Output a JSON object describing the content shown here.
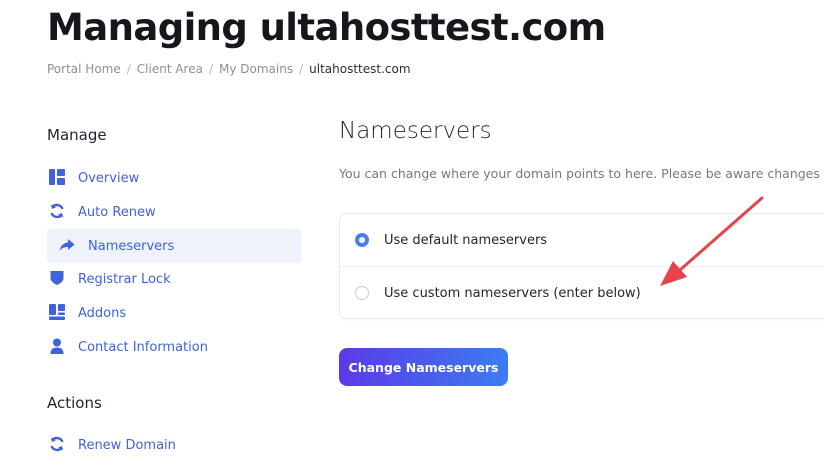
{
  "page": {
    "title": "Managing ultahosttest.com"
  },
  "breadcrumb": {
    "items": [
      "Portal Home",
      "Client Area",
      "My Domains"
    ],
    "separator": "/",
    "current": "ultahosttest.com"
  },
  "sidebar": {
    "manage_heading": "Manage",
    "items": [
      {
        "label": "Overview",
        "icon": "dashboard-icon"
      },
      {
        "label": "Auto Renew",
        "icon": "sync-icon"
      },
      {
        "label": "Nameservers",
        "icon": "share-arrow-icon",
        "active": true
      },
      {
        "label": "Registrar Lock",
        "icon": "shield-icon"
      },
      {
        "label": "Addons",
        "icon": "cubes-icon"
      },
      {
        "label": "Contact Information",
        "icon": "user-icon"
      }
    ],
    "actions_heading": "Actions",
    "actions": [
      {
        "label": "Renew Domain",
        "icon": "sync-icon"
      }
    ]
  },
  "main": {
    "title": "Nameservers",
    "description": "You can change where your domain points to here. Please be aware changes",
    "options": [
      {
        "label": "Use default nameservers",
        "checked": true
      },
      {
        "label": "Use custom nameservers (enter below)",
        "checked": false
      }
    ],
    "submit_label": "Change Nameservers"
  },
  "colors": {
    "accent": "#3f63d8",
    "button_gradient_start": "#5b3ae6",
    "button_gradient_end": "#3d7cf2",
    "annotation_arrow": "#e8424a"
  }
}
